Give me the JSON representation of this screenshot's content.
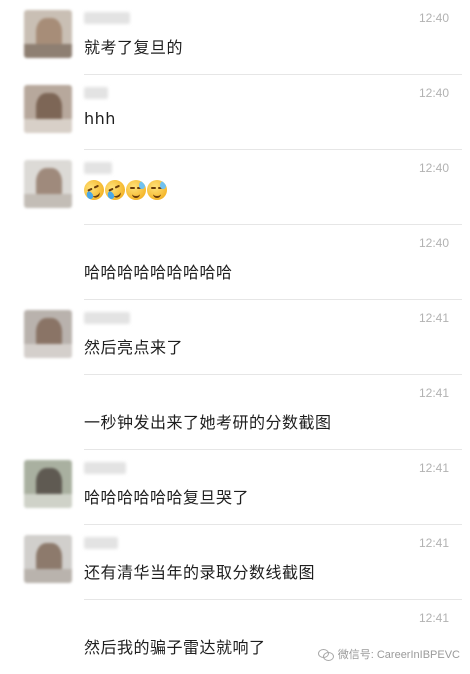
{
  "messages": [
    {
      "time": "12:40",
      "text": "就考了复旦的"
    },
    {
      "time": "12:40",
      "text": "hhh"
    },
    {
      "time": "12:40",
      "text": "",
      "emojis": [
        "crying-laughing-emoji",
        "crying-laughing-emoji",
        "sweat-smile-emoji",
        "sweat-smile-emoji"
      ]
    },
    {
      "time": "12:40",
      "text": "哈哈哈哈哈哈哈哈哈"
    },
    {
      "time": "12:41",
      "text": "然后亮点来了"
    },
    {
      "time": "12:41",
      "text": "一秒钟发出来了她考研的分数截图"
    },
    {
      "time": "12:41",
      "text": "哈哈哈哈哈哈复旦哭了"
    },
    {
      "time": "12:41",
      "text": "还有清华当年的录取分数线截图"
    },
    {
      "time": "12:41",
      "text": "然后我的骗子雷达就响了"
    }
  ],
  "watermark": {
    "icon": "wechat-icon",
    "text": "微信号: CareerInIBPEVC"
  },
  "colors": {
    "timestamp": "#b2b2b2",
    "divider": "#e6e6e6",
    "text": "#1e1e1e"
  }
}
